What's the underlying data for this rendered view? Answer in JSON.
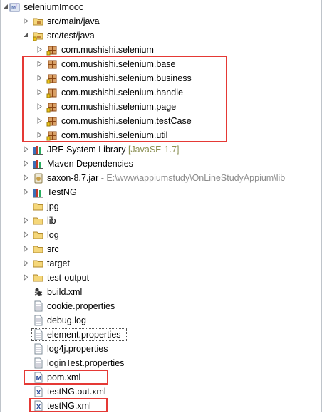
{
  "project": {
    "name": "seleniumImooc",
    "items": [
      {
        "label": "src/main/java",
        "icon": "source-folder-icon"
      },
      {
        "label": "src/test/java",
        "icon": "source-folder-icon",
        "packages": [
          "com.mushishi.selenium",
          "com.mushishi.selenium.base",
          "com.mushishi.selenium.business",
          "com.mushishi.selenium.handle",
          "com.mushishi.selenium.page",
          "com.mushishi.selenium.testCase",
          "com.mushishi.selenium.util"
        ]
      },
      {
        "label": "JRE System Library",
        "decoration": "[JavaSE-1.7]",
        "icon": "library-icon"
      },
      {
        "label": "Maven Dependencies",
        "icon": "library-icon"
      },
      {
        "label": "saxon-8.7.jar",
        "decoration": "- E:\\www\\appiumstudy\\OnLineStudyAppium\\lib",
        "icon": "jar-icon"
      },
      {
        "label": "TestNG",
        "icon": "library-icon"
      },
      {
        "label": "jpg",
        "icon": "folder-icon"
      },
      {
        "label": "lib",
        "icon": "folder-icon"
      },
      {
        "label": "log",
        "icon": "folder-icon"
      },
      {
        "label": "src",
        "icon": "folder-icon"
      },
      {
        "label": "target",
        "icon": "folder-icon"
      },
      {
        "label": "test-output",
        "icon": "folder-icon"
      },
      {
        "label": "build.xml",
        "icon": "ant-file-icon"
      },
      {
        "label": "cookie.properties",
        "icon": "text-file-icon"
      },
      {
        "label": "debug.log",
        "icon": "text-file-icon"
      },
      {
        "label": "element.properties",
        "icon": "text-file-icon"
      },
      {
        "label": "log4j.properties",
        "icon": "text-file-icon"
      },
      {
        "label": "loginTest.properties",
        "icon": "text-file-icon"
      },
      {
        "label": "pom.xml",
        "icon": "maven-pom-icon"
      },
      {
        "label": "testNG.out.xml",
        "icon": "xml-file-icon"
      },
      {
        "label": "testNG.xml",
        "icon": "xml-file-icon"
      }
    ]
  },
  "colors": {
    "highlight_border": "#e53935",
    "decoration_text": "#8a8f52",
    "folder_yellow": "#f5d77a",
    "package_brown": "#b5651d"
  }
}
